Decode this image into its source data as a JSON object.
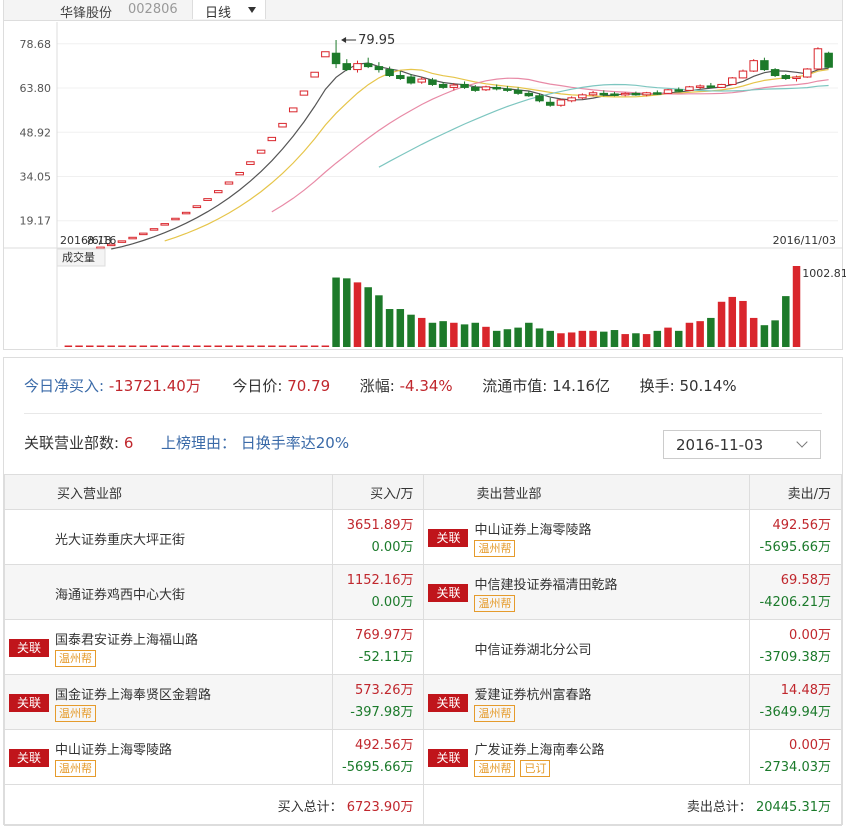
{
  "header": {
    "stock_name": "华锋股份",
    "stock_code": "002806",
    "period": "日线"
  },
  "chart_data": [
    {
      "type": "candlestick",
      "y_ticks": [
        "78.68",
        "63.80",
        "48.92",
        "34.05",
        "19.17"
      ],
      "ylim": [
        10.0,
        86.0
      ],
      "start_label": "2016/6/16",
      "end_label": "2016/11/03",
      "high_marker": "79.95",
      "low_marker": "8.18",
      "series_colors": {
        "up": "#d9262c",
        "down": "#1d7a2a",
        "ma5": "#555555",
        "ma10": "#e6c54a",
        "ma20": "#e88aa6",
        "ma60": "#7dc6c0"
      },
      "candles": [
        [
          8.2,
          8.5,
          8.2,
          8.5
        ],
        [
          8.6,
          8.8,
          8.6,
          8.8
        ],
        [
          9.1,
          9.4,
          9.1,
          9.4
        ],
        [
          10.0,
          10.3,
          10.0,
          10.3
        ],
        [
          11.0,
          11.3,
          11.0,
          11.3
        ],
        [
          12.0,
          12.4,
          12.0,
          12.4
        ],
        [
          13.3,
          13.6,
          13.3,
          13.6
        ],
        [
          14.6,
          15.0,
          14.6,
          15.0
        ],
        [
          16.1,
          16.5,
          16.1,
          16.5
        ],
        [
          17.7,
          18.2,
          17.7,
          18.2
        ],
        [
          19.5,
          20.0,
          19.5,
          20.0
        ],
        [
          21.5,
          22.0,
          21.5,
          22.0
        ],
        [
          23.6,
          24.2,
          23.6,
          24.2
        ],
        [
          26.0,
          26.6,
          26.0,
          26.6
        ],
        [
          28.6,
          29.3,
          28.6,
          29.3
        ],
        [
          31.5,
          32.2,
          31.5,
          32.2
        ],
        [
          34.6,
          35.4,
          34.6,
          35.4
        ],
        [
          38.1,
          39.0,
          38.1,
          39.0
        ],
        [
          41.9,
          42.9,
          41.9,
          42.9
        ],
        [
          46.1,
          47.2,
          46.1,
          47.2
        ],
        [
          50.7,
          51.9,
          50.7,
          51.9
        ],
        [
          55.8,
          57.1,
          55.8,
          57.1
        ],
        [
          61.4,
          62.8,
          61.4,
          62.8
        ],
        [
          67.5,
          69.1,
          67.5,
          69.1
        ],
        [
          74.3,
          76.0,
          74.3,
          76.0
        ],
        [
          75.5,
          79.95,
          70.5,
          72.0
        ],
        [
          72.0,
          73.5,
          69.5,
          70.0
        ],
        [
          70.0,
          73.0,
          69.0,
          72.0
        ],
        [
          72.0,
          74.0,
          70.5,
          71.0
        ],
        [
          71.0,
          72.5,
          69.0,
          70.0
        ],
        [
          70.0,
          71.0,
          67.5,
          68.0
        ],
        [
          68.0,
          69.5,
          66.5,
          67.0
        ],
        [
          67.5,
          68.5,
          65.0,
          65.5
        ],
        [
          65.8,
          67.5,
          65.2,
          66.8
        ],
        [
          66.5,
          67.2,
          64.5,
          65.0
        ],
        [
          65.0,
          65.8,
          63.5,
          64.0
        ],
        [
          64.0,
          65.5,
          63.0,
          64.8
        ],
        [
          65.0,
          66.0,
          63.5,
          64.0
        ],
        [
          64.0,
          64.8,
          62.5,
          63.0
        ],
        [
          63.2,
          64.6,
          62.8,
          64.2
        ],
        [
          64.0,
          65.0,
          63.0,
          63.5
        ],
        [
          63.5,
          64.5,
          62.5,
          63.0
        ],
        [
          63.0,
          64.0,
          61.5,
          62.0
        ],
        [
          62.0,
          62.8,
          60.8,
          61.2
        ],
        [
          61.2,
          62.0,
          59.0,
          59.5
        ],
        [
          59.0,
          60.5,
          57.5,
          58.0
        ],
        [
          58.0,
          60.2,
          57.5,
          59.8
        ],
        [
          59.5,
          61.0,
          59.0,
          60.5
        ],
        [
          60.5,
          62.0,
          60.0,
          61.5
        ],
        [
          61.5,
          62.8,
          61.0,
          62.2
        ],
        [
          62.0,
          63.0,
          61.0,
          61.8
        ],
        [
          61.8,
          62.5,
          61.0,
          61.5
        ],
        [
          61.5,
          62.4,
          61.0,
          62.0
        ],
        [
          62.0,
          62.6,
          61.2,
          61.5
        ],
        [
          61.5,
          62.5,
          61.0,
          62.2
        ],
        [
          62.2,
          63.0,
          61.5,
          62.0
        ],
        [
          62.0,
          63.5,
          61.8,
          63.2
        ],
        [
          63.2,
          64.0,
          62.5,
          63.0
        ],
        [
          63.0,
          64.5,
          62.8,
          64.2
        ],
        [
          64.2,
          65.0,
          63.5,
          64.5
        ],
        [
          64.5,
          65.5,
          64.0,
          64.0
        ],
        [
          64.0,
          65.2,
          63.8,
          65.0
        ],
        [
          65.0,
          67.5,
          64.8,
          67.2
        ],
        [
          67.2,
          70.0,
          67.0,
          69.5
        ],
        [
          69.5,
          73.5,
          69.2,
          73.0
        ],
        [
          73.0,
          74.0,
          69.5,
          70.0
        ],
        [
          70.0,
          70.5,
          67.5,
          68.0
        ],
        [
          68.0,
          68.5,
          66.5,
          67.0
        ],
        [
          67.0,
          68.0,
          66.0,
          67.5
        ],
        [
          67.5,
          70.5,
          67.2,
          70.2
        ],
        [
          70.2,
          77.5,
          70.0,
          77.0
        ],
        [
          75.5,
          76.0,
          70.5,
          70.79
        ]
      ],
      "volume": {
        "label": "成交量",
        "max_label": "1002.81万",
        "values": [
          3,
          3,
          3,
          3,
          3,
          3,
          3,
          3,
          3,
          3,
          3,
          3,
          3,
          3,
          3,
          3,
          3,
          3,
          3,
          3,
          3,
          3,
          3,
          3,
          3,
          860,
          850,
          800,
          740,
          640,
          470,
          470,
          400,
          360,
          300,
          320,
          300,
          280,
          300,
          250,
          200,
          220,
          240,
          300,
          230,
          200,
          170,
          180,
          200,
          200,
          190,
          210,
          160,
          170,
          160,
          200,
          240,
          200,
          300,
          320,
          360,
          560,
          620,
          570,
          360,
          270,
          330,
          630,
          1002.81
        ]
      }
    }
  ],
  "summary": {
    "net_buy_label": "今日净买入:",
    "net_buy_value": "-13721.40万",
    "price_label": "今日价:",
    "price_value": "70.79",
    "change_label": "涨幅:",
    "change_value": "-4.34%",
    "mktcap_label": "流通市值:",
    "mktcap_value": "14.16亿",
    "turnover_label": "换手:",
    "turnover_value": "50.14%",
    "branches_label": "关联营业部数:",
    "branches_value": "6",
    "reason_label": "上榜理由：",
    "reason_value": "日换手率达20%",
    "date": "2016-11-03"
  },
  "table": {
    "buy_header": "买入营业部",
    "buy_amount_header": "买入/万",
    "sell_header": "卖出营业部",
    "sell_amount_header": "卖出/万",
    "rows": [
      {
        "buy_name": "光大证券重庆大坪正街",
        "buy_tag": "",
        "buy_badges": [],
        "buy_v1": "3651.89万",
        "buy_v2": "0.00万",
        "sell_name": "中山证券上海零陵路",
        "sell_tag": "关联",
        "sell_badges": [
          "温州帮"
        ],
        "sell_v1": "492.56万",
        "sell_v2": "-5695.66万"
      },
      {
        "buy_name": "海通证券鸡西中心大街",
        "buy_tag": "",
        "buy_badges": [],
        "buy_v1": "1152.16万",
        "buy_v2": "0.00万",
        "sell_name": "中信建投证券福清田乾路",
        "sell_tag": "关联",
        "sell_badges": [
          "温州帮"
        ],
        "sell_v1": "69.58万",
        "sell_v2": "-4206.21万"
      },
      {
        "buy_name": "国泰君安证券上海福山路",
        "buy_tag": "关联",
        "buy_badges": [
          "温州帮"
        ],
        "buy_v1": "769.97万",
        "buy_v2": "-52.11万",
        "sell_name": "中信证券湖北分公司",
        "sell_tag": "",
        "sell_badges": [],
        "sell_v1": "0.00万",
        "sell_v2": "-3709.38万"
      },
      {
        "buy_name": "国金证券上海奉贤区金碧路",
        "buy_tag": "关联",
        "buy_badges": [
          "温州帮"
        ],
        "buy_v1": "573.26万",
        "buy_v2": "-397.98万",
        "sell_name": "爱建证券杭州富春路",
        "sell_tag": "关联",
        "sell_badges": [
          "温州帮"
        ],
        "sell_v1": "14.48万",
        "sell_v2": "-3649.94万"
      },
      {
        "buy_name": "中山证券上海零陵路",
        "buy_tag": "关联",
        "buy_badges": [
          "温州帮"
        ],
        "buy_v1": "492.56万",
        "buy_v2": "-5695.66万",
        "sell_name": "广发证券上海南奉公路",
        "sell_tag": "关联",
        "sell_badges": [
          "温州帮",
          "已订"
        ],
        "sell_v1": "0.00万",
        "sell_v2": "-2734.03万"
      }
    ],
    "buy_total_label": "买入总计：",
    "buy_total_value": "6723.90万",
    "sell_total_label": "卖出总计：",
    "sell_total_value": "20445.31万"
  }
}
